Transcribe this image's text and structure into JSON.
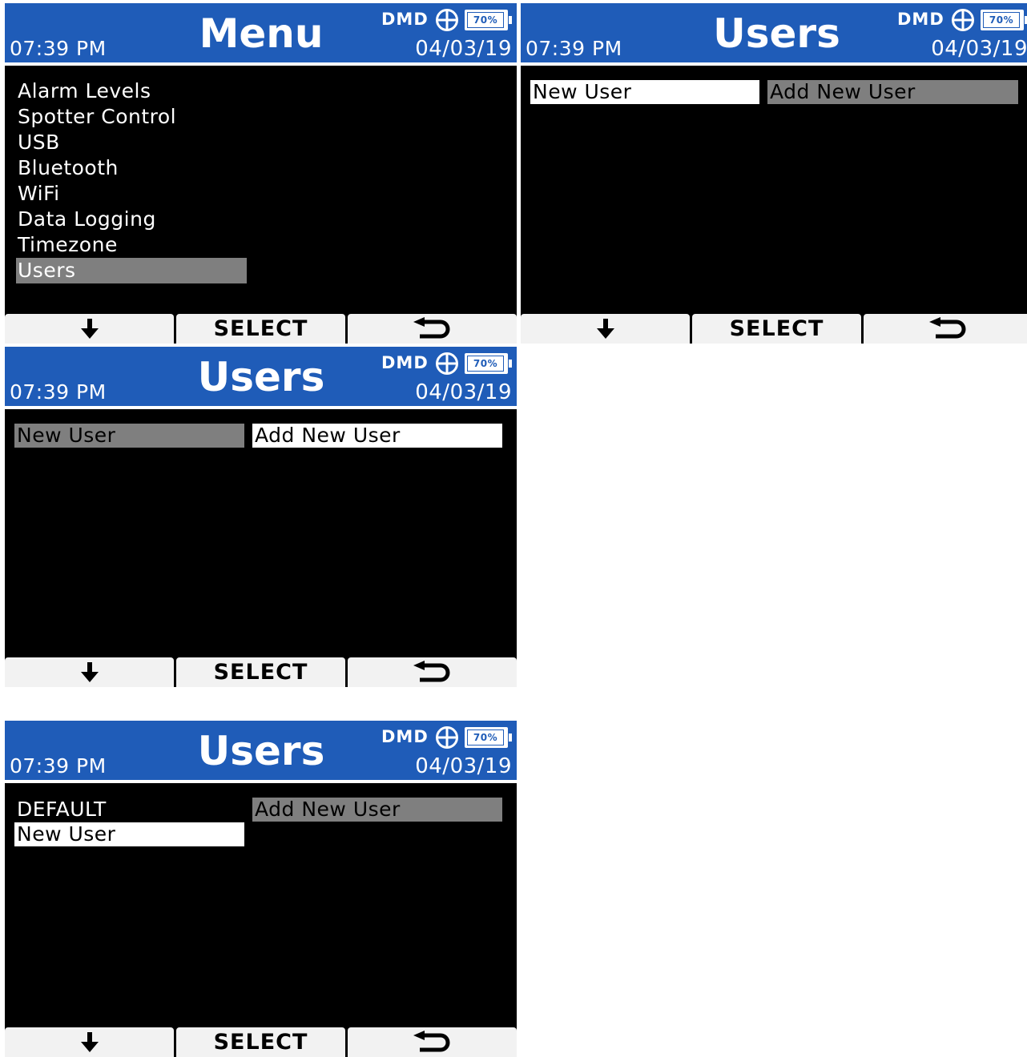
{
  "colors": {
    "header_blue": "#1f5cb8",
    "screen_bg": "#000000",
    "highlight_white": "#ffffff",
    "highlight_grey": "#7f7f7f",
    "softkey_bg": "#f2f2f2"
  },
  "status": {
    "time": "07:39 PM",
    "brand": "DMD",
    "battery": "70%",
    "date": "04/03/19",
    "network_icon": "globe-plus-icon"
  },
  "softkeys": {
    "down_icon": "arrow-down-icon",
    "select_label": "SELECT",
    "back_icon": "return-arrow-icon"
  },
  "screens": [
    {
      "title": "Menu",
      "menu_items": [
        {
          "label": "Alarm Levels",
          "selected": false
        },
        {
          "label": "Spotter Control",
          "selected": false
        },
        {
          "label": "USB",
          "selected": false
        },
        {
          "label": "Bluetooth",
          "selected": false
        },
        {
          "label": "WiFi",
          "selected": false
        },
        {
          "label": "Data Logging",
          "selected": false
        },
        {
          "label": "Timezone",
          "selected": false
        },
        {
          "label": "Users",
          "selected": true
        }
      ]
    },
    {
      "title": "Users",
      "left_col": [
        {
          "label": "New User",
          "state": "white"
        }
      ],
      "right_col": [
        {
          "label": "Add New User",
          "state": "grey"
        }
      ]
    },
    {
      "title": "Users",
      "left_col": [
        {
          "label": "New User",
          "state": "grey"
        }
      ],
      "right_col": [
        {
          "label": "Add New User",
          "state": "white"
        }
      ]
    },
    {
      "title": "Users",
      "left_col": [
        {
          "label": "DEFAULT",
          "state": "plain"
        },
        {
          "label": "New User",
          "state": "white"
        }
      ],
      "right_col": [
        {
          "label": "Add New User",
          "state": "grey"
        }
      ]
    }
  ]
}
